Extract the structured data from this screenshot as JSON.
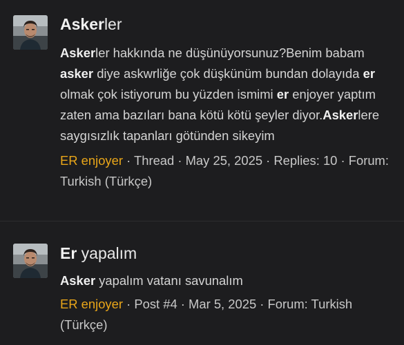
{
  "results": [
    {
      "title": {
        "highlight": "Asker",
        "rest": "ler"
      },
      "snippet": [
        {
          "text": "Asker",
          "bold": true
        },
        {
          "text": "ler hakkında ne düşünüyorsunuz?Benim babam ",
          "bold": false
        },
        {
          "text": "asker",
          "bold": true
        },
        {
          "text": " diye askwrliğe çok düşkünüm bundan dolayıda ",
          "bold": false
        },
        {
          "text": "er",
          "bold": true
        },
        {
          "text": " olmak çok istiyorum bu yüzden ismimi ",
          "bold": false
        },
        {
          "text": "er",
          "bold": true
        },
        {
          "text": " enjoyer yaptım zaten ama bazıları bana kötü kötü şeyler diyor.",
          "bold": false
        },
        {
          "text": "Asker",
          "bold": true
        },
        {
          "text": "lere saygısızlık tapanları götünden sikeyim",
          "bold": false
        }
      ],
      "meta": {
        "author": "ER enjoyer",
        "rest": " · Thread · May 25, 2025 · Replies: 10 · Forum: Turkish (Türkçe)"
      }
    },
    {
      "title": {
        "highlight": "Er",
        "rest": " yapalım"
      },
      "snippet": [
        {
          "text": "Asker",
          "bold": true
        },
        {
          "text": " yapalım vatanı savunalım",
          "bold": false
        }
      ],
      "meta": {
        "author": "ER enjoyer",
        "rest": " · Post #4 · Mar 5, 2025 · Forum: Turkish (Türkçe)"
      }
    }
  ],
  "colors": {
    "background": "#1d1d1f",
    "author_link": "#e9a619",
    "text": "#d4d4d4"
  },
  "icons": {
    "avatar": "user-avatar-photo"
  }
}
